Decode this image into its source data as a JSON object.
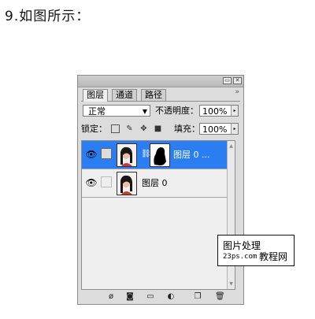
{
  "heading": "9.如图所示：",
  "panel": {
    "title_buttons": {
      "minimize": "▭",
      "close": "✕"
    },
    "panel_menu": "»",
    "tabs": [
      {
        "label": "图层",
        "active": true
      },
      {
        "label": "通道",
        "active": false
      },
      {
        "label": "路径",
        "active": false
      }
    ],
    "blend_mode": "正常",
    "opacity_label": "不透明度：",
    "opacity_value": "100%",
    "lock_label": "锁定：",
    "fill_label": "填充：",
    "fill_value": "100%",
    "lock_icons": [
      "lock-transparent-icon",
      "lock-brush-icon",
      "lock-move-icon",
      "lock-all-icon"
    ],
    "layers": [
      {
        "name": "图层 0 ...",
        "selected": true,
        "has_mask": true
      },
      {
        "name": "图层 0",
        "selected": false,
        "has_mask": false
      }
    ],
    "bottom_icons": [
      "link-icon",
      "layer-style-icon",
      "add-mask-icon",
      "new-group-icon",
      "adjustment-layer-icon",
      "new-layer-icon",
      "trash-icon"
    ]
  },
  "watermark": {
    "line1": "图片处理",
    "line2": "23ps.com",
    "line3": "教程网"
  },
  "colors": {
    "selection": "#2b7df2",
    "panel_bg": "#dcdcdc"
  }
}
